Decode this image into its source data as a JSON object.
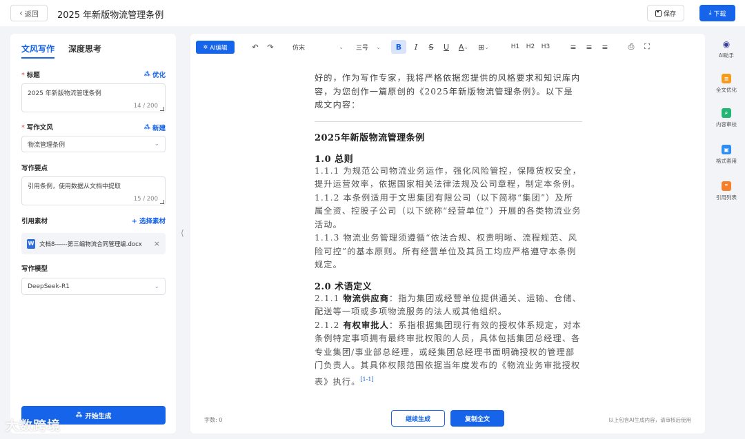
{
  "header": {
    "back_label": "返回",
    "title": "2025 年新版物流管理条例",
    "save_label": "保存",
    "download_label": "下载"
  },
  "left": {
    "tabs": [
      {
        "label": "文风写作",
        "active": true
      },
      {
        "label": "深度思考",
        "active": false
      }
    ],
    "title_field": {
      "label": "标题",
      "action": "优化",
      "value": "2025 年新版物流管理条例",
      "count": "14 / 200"
    },
    "style_field": {
      "label": "写作文风",
      "action": "新建",
      "value": "物流管理条例"
    },
    "points_field": {
      "label": "写作要点",
      "value": "引用条例，使用数据从文档中提取",
      "count": "15 / 200"
    },
    "material": {
      "label": "引用素材",
      "action": "+ 选择素材",
      "file_name": "文档8------第三编物流合同管理编.docx"
    },
    "model": {
      "label": "写作模型",
      "value": "DeepSeek-R1"
    },
    "generate_label": "开始生成"
  },
  "toolbar": {
    "ai_edit": "AI编辑",
    "font": "仿宋",
    "size": "三号",
    "h1": "H1",
    "h2": "H2",
    "h3": "H3"
  },
  "document": {
    "intro": "好的，作为写作专家，我将严格依据您提供的风格要求和知识库内容，为您创作一篇原创的《2025年新版物流管理条例》。以下是成文内容：",
    "main_title": "2025年新版物流管理条例",
    "sec1_heading": "1.0 总则",
    "sec1_p1": "1.1.1 为规范公司物流业务运作，强化风险管控，保障货权安全，提升运营效率，依据国家相关法律法规及公司章程，制定本条例。",
    "sec1_p2": "1.1.2 本条例适用于文思集团有限公司（以下简称“集团”）及所属全资、控股子公司（以下统称“经营单位”）开展的各类物流业务活动。",
    "sec1_p3": "1.1.3 物流业务管理须遵循“依法合规、权责明晰、流程规范、风险可控”的基本原则。所有经营单位及其员工均应严格遵守本条例规定。",
    "sec2_heading": "2.0 术语定义",
    "sec2_p1_num": "2.1.1 ",
    "sec2_p1_term": "物流供应商",
    "sec2_p1_rest": "：指为集团或经营单位提供通关、运输、仓储、配送等一项或多项物流服务的法人或其他组织。",
    "sec2_p2_num": "2.1.2 ",
    "sec2_p2_term": "有权审批人",
    "sec2_p2_rest": "：系指根据集团现行有效的授权体系规定，对本条例特定事项拥有最终审批权限的人员，具体包括集团总经理、各专业集团/事业部总经理，或经集团总经理书面明确授权的管理部门负责人。其具体权限范围依据当年度发布的《物流业务审批授权表》执行。",
    "citation": "[1-1]"
  },
  "footer": {
    "word_count": "字数: 0",
    "continue_label": "继续生成",
    "copy_label": "复制全文",
    "disclaimer": "以上包含AI生成内容，请审核后使用"
  },
  "right_bar": [
    {
      "label": "AI助手",
      "color": "#3a3f99"
    },
    {
      "label": "全文优化",
      "color": "#f39a1f"
    },
    {
      "label": "内容审校",
      "color": "#22b573"
    },
    {
      "label": "格式套用",
      "color": "#2f8cf0"
    },
    {
      "label": "引用列表",
      "color": "#f57f2a"
    }
  ],
  "watermark": "大数跨境"
}
